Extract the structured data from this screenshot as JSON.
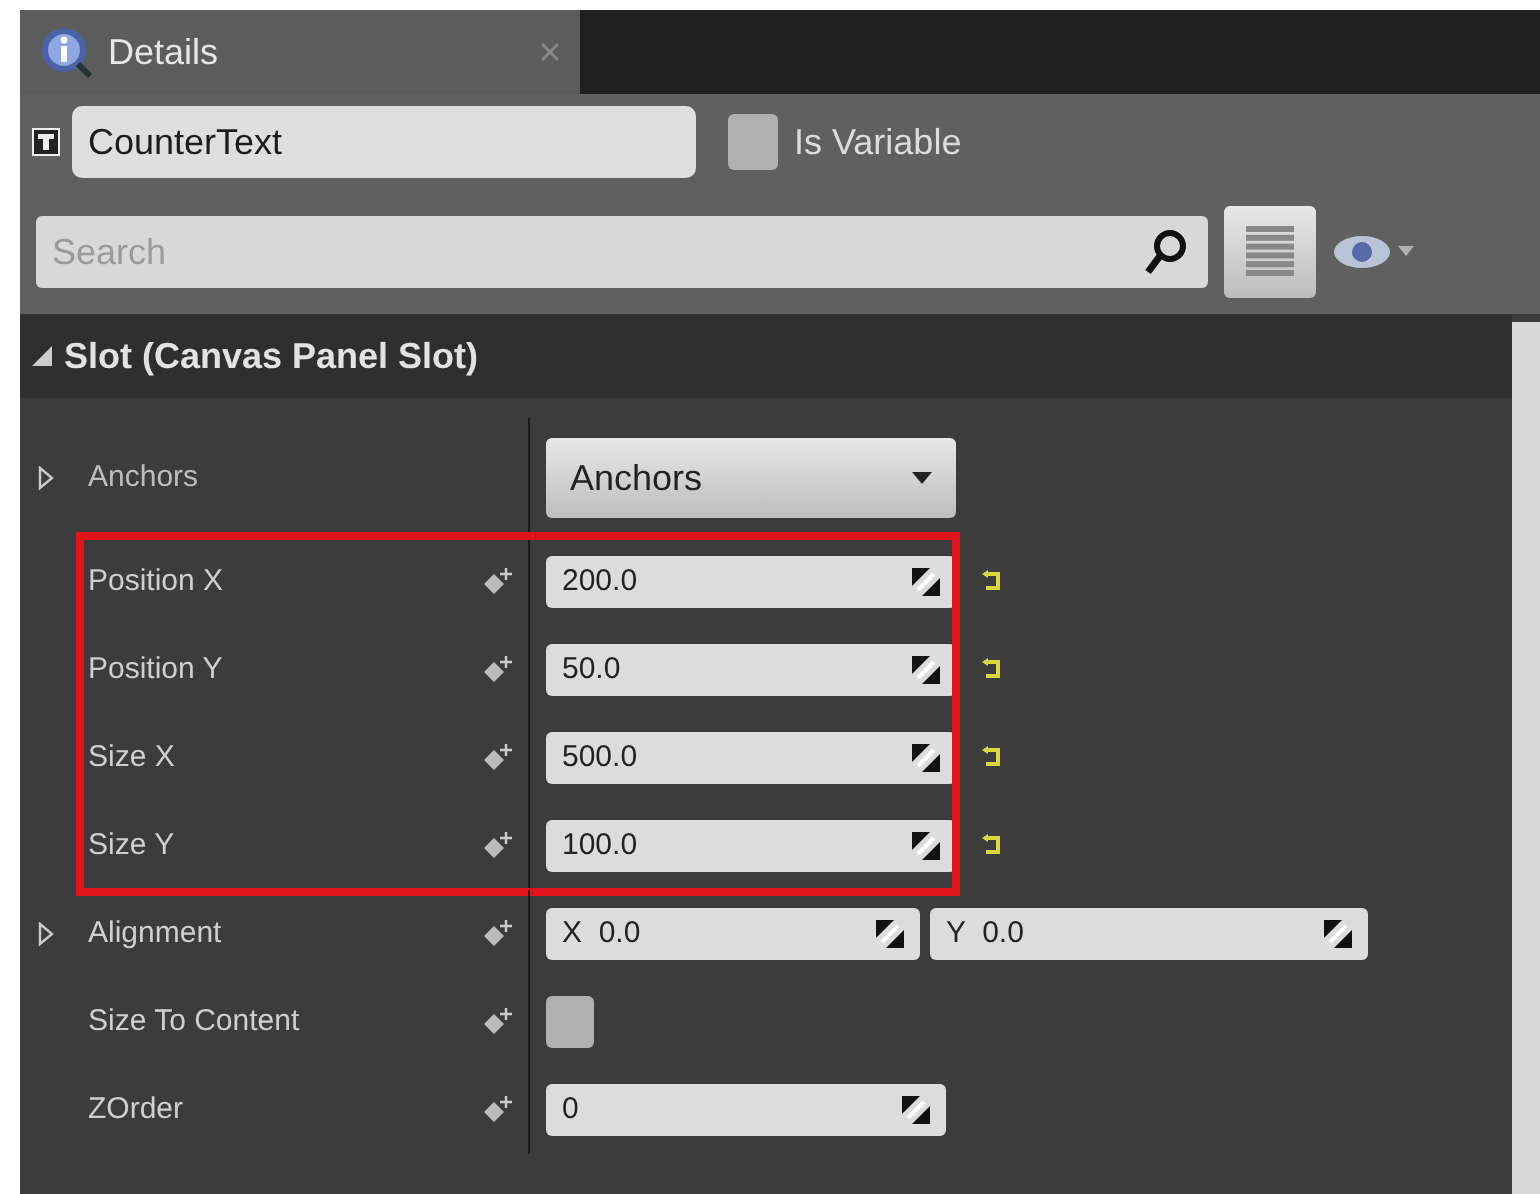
{
  "tab": {
    "title": "Details",
    "selected": true
  },
  "widget": {
    "name": "CounterText",
    "is_variable": {
      "label": "Is Variable",
      "checked": false
    }
  },
  "search": {
    "placeholder": "Search"
  },
  "section": {
    "title": "Slot (Canvas Panel Slot)",
    "expanded": true
  },
  "properties": [
    {
      "kind": "dropdown",
      "label": "Anchors",
      "expandable": true,
      "value": "Anchors",
      "highlighted": false
    },
    {
      "kind": "number",
      "label": "Position X",
      "value": "200.0",
      "highlighted": true,
      "resettable": true
    },
    {
      "kind": "number",
      "label": "Position Y",
      "value": "50.0",
      "highlighted": true,
      "resettable": true
    },
    {
      "kind": "number",
      "label": "Size X",
      "value": "500.0",
      "highlighted": true,
      "resettable": true
    },
    {
      "kind": "number",
      "label": "Size Y",
      "value": "100.0",
      "highlighted": true,
      "resettable": true
    },
    {
      "kind": "vector2",
      "label": "Alignment",
      "expandable": true,
      "x": "X  0.0",
      "y": "Y  0.0",
      "highlighted": false
    },
    {
      "kind": "checkbox",
      "label": "Size To Content",
      "checked": false,
      "highlighted": false
    },
    {
      "kind": "integer",
      "label": "ZOrder",
      "value": "0",
      "highlighted": false
    }
  ]
}
